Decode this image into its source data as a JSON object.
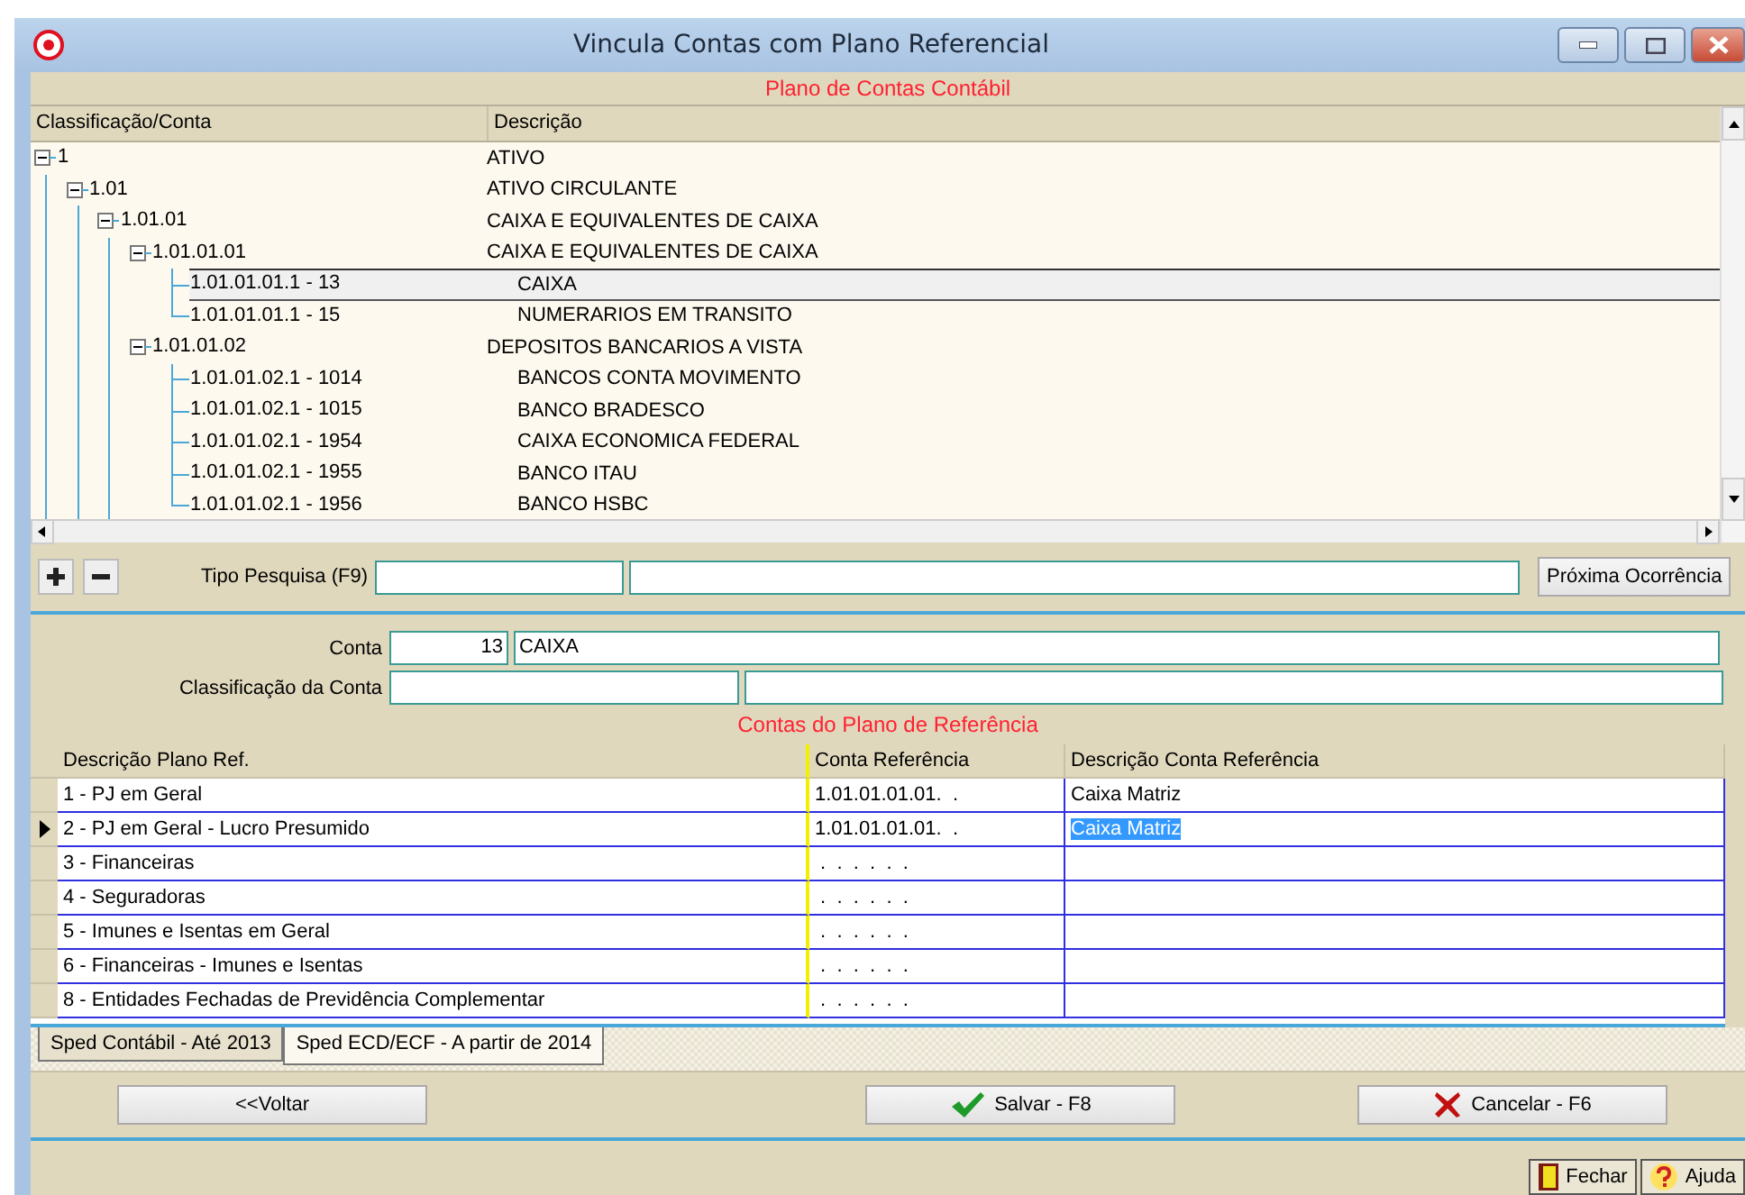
{
  "window": {
    "title": "Vincula Contas com Plano Referencial"
  },
  "chart_of_accounts": {
    "heading": "Plano de Contas Contábil",
    "columns": [
      "Classificação/Conta",
      "Descrição"
    ],
    "tree": [
      {
        "code": "1",
        "description": "ATIVO",
        "expanded": true,
        "selected": false,
        "children": [
          {
            "code": "1.01",
            "description": "ATIVO CIRCULANTE",
            "expanded": true,
            "selected": false,
            "children": [
              {
                "code": "1.01.01",
                "description": "CAIXA E EQUIVALENTES DE CAIXA",
                "expanded": true,
                "selected": false,
                "children": [
                  {
                    "code": "1.01.01.01",
                    "description": "CAIXA E EQUIVALENTES DE CAIXA",
                    "expanded": true,
                    "selected": false,
                    "children": [
                      {
                        "code": "1.01.01.01.1 - 13",
                        "description": "CAIXA",
                        "selected": true
                      },
                      {
                        "code": "1.01.01.01.1 - 15",
                        "description": "NUMERARIOS EM TRANSITO",
                        "selected": false
                      }
                    ]
                  },
                  {
                    "code": "1.01.01.02",
                    "description": "DEPOSITOS BANCARIOS A VISTA",
                    "expanded": true,
                    "selected": false,
                    "children": [
                      {
                        "code": "1.01.01.02.1 - 1014",
                        "description": "BANCOS CONTA MOVIMENTO",
                        "selected": false
                      },
                      {
                        "code": "1.01.01.02.1 - 1015",
                        "description": "BANCO BRADESCO",
                        "selected": false
                      },
                      {
                        "code": "1.01.01.02.1 - 1954",
                        "description": "CAIXA ECONOMICA FEDERAL",
                        "selected": false
                      },
                      {
                        "code": "1.01.01.02.1 - 1955",
                        "description": "BANCO ITAU",
                        "selected": false
                      },
                      {
                        "code": "1.01.01.02.1 - 1956",
                        "description": "BANCO HSBC",
                        "selected": false
                      }
                    ]
                  }
                ]
              }
            ]
          }
        ]
      }
    ]
  },
  "search": {
    "label": "Tipo Pesquisa (F9)",
    "next_button": "Próxima Ocorrência"
  },
  "account": {
    "label": "Conta",
    "code": "13",
    "name": "CAIXA"
  },
  "classification": {
    "label": "Classificação da Conta"
  },
  "reference": {
    "heading": "Contas do Plano de Referência",
    "columns": [
      "Descrição Plano Ref.",
      "Conta Referência",
      "Descrição Conta Referência"
    ],
    "rows": [
      {
        "description": "1 - PJ em Geral",
        "account": "1.01.01.01.01.  .",
        "account_description": "Caixa Matriz",
        "selected": false
      },
      {
        "description": "2 - PJ em Geral - Lucro Presumido",
        "account": "1.01.01.01.01.  .",
        "account_description": "Caixa Matriz",
        "selected": true
      },
      {
        "description": "3 - Financeiras",
        "account": " .  .  .  .  .  .",
        "selected": false
      },
      {
        "description": "4 - Seguradoras",
        "account": " .  .  .  .  .  .",
        "selected": false
      },
      {
        "description": "5 - Imunes e Isentas em Geral",
        "account": " .  .  .  .  .  .",
        "selected": false
      },
      {
        "description": "6 - Financeiras - Imunes e Isentas",
        "account": " .  .  .  .  .  .",
        "selected": false
      },
      {
        "description": "8 - Entidades Fechadas de Previdência Complementar",
        "account": " .  .  .  .  .  .",
        "selected": false
      }
    ]
  },
  "tabs": [
    {
      "label": "Sped Contábil - Até 2013",
      "selected": false
    },
    {
      "label": "Sped ECD/ECF - A partir de 2014",
      "selected": true
    }
  ],
  "buttons": [
    {
      "kind": "back",
      "label": "<<Voltar"
    },
    {
      "kind": "save",
      "label": "Salvar - F8"
    },
    {
      "kind": "cancel",
      "label": "Cancelar - F6"
    }
  ],
  "footer_buttons": [
    {
      "kind": "close",
      "label": "Fechar"
    },
    {
      "kind": "help",
      "label": "Ajuda"
    }
  ]
}
